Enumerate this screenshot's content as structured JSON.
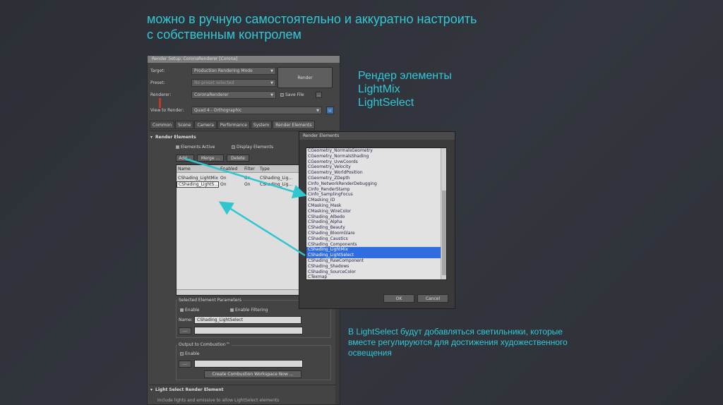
{
  "slide": {
    "title": "можно в ручную самостоятельно и аккуратно настроить\nс собственным контролем",
    "side_note": [
      "Рендер элементы",
      "LightMix",
      "LightSelect"
    ],
    "bottom_note": "В LightSelect будут добавляться светильники, которые вместе регулируются для достижения художественного освещения"
  },
  "render_setup": {
    "title": "Render Setup: CoronaRenderer [Corona]",
    "target_label": "Target:",
    "target_value": "Production Rendering Mode",
    "preset_label": "Preset:",
    "preset_value": "No preset selected",
    "renderer_label": "Renderer:",
    "renderer_value": "CoronaRenderer",
    "save_file_label": "Save File",
    "view_label": "View to Render:",
    "view_value": "Quad 4 - Orthographic",
    "render_button": "Render",
    "tabs": [
      "Common",
      "Scene",
      "Camera",
      "Performance",
      "System",
      "Render Elements"
    ],
    "active_tab": "Render Elements",
    "section_render_elements": "Render Elements",
    "elements_active_label": "Elements Active",
    "display_elements_label": "Display Elements",
    "add_button": "Add...",
    "merge_button": "Merge ...",
    "delete_button": "Delete",
    "table_headers": [
      "Name",
      "Enabled",
      "Filter",
      "Type"
    ],
    "table_rows": [
      [
        "CShading_LightMix",
        "On",
        "On",
        "CShading_Lig..."
      ],
      [
        "CShading_LightS...",
        "On",
        "On",
        "CShading_Lig..."
      ]
    ],
    "selected_params_label": "Selected Element Parameters",
    "enable_label": "Enable",
    "enable_filtering_label": "Enable Filtering",
    "name_label": "Name:",
    "name_value": "CShading_LightSelect",
    "output_combustion_label": "Output to Combustion™",
    "combustion_enable_label": "Enable",
    "create_workspace_button": "Create Combustion Workspace Now ...",
    "section_light_select": "Light Select Render Element",
    "footer_text": "Include lights and emissive to allow LightSelect elements"
  },
  "picker": {
    "title": "Render Elements",
    "items": [
      "CGeometry_NormalsGeometry",
      "CGeometry_NormalsShading",
      "CGeometry_UvwCoords",
      "CGeometry_Velocity",
      "CGeometry_WorldPosition",
      "CGeometry_ZDepth",
      "CInfo_NetworkRenderDebugging",
      "CInfo_RenderStamp",
      "CInfo_SamplingFocus",
      "CMasking_ID",
      "CMasking_Mask",
      "CMasking_WireColor",
      "CShading_Albedo",
      "CShading_Alpha",
      "CShading_Beauty",
      "CShading_BloomGlare",
      "CShading_Caustics",
      "CShading_Components",
      "CShading_LightMix",
      "CShading_LightSelect",
      "CShading_RawComponent",
      "CShading_Shadows",
      "CShading_SourceColor",
      "CTexmap"
    ],
    "highlighted": [
      "CShading_LightMix",
      "CShading_LightSelect"
    ],
    "ok_button": "OK",
    "cancel_button": "Cancel"
  },
  "colors": {
    "accent": "#33c8d6",
    "highlight": "#2f6de0"
  }
}
